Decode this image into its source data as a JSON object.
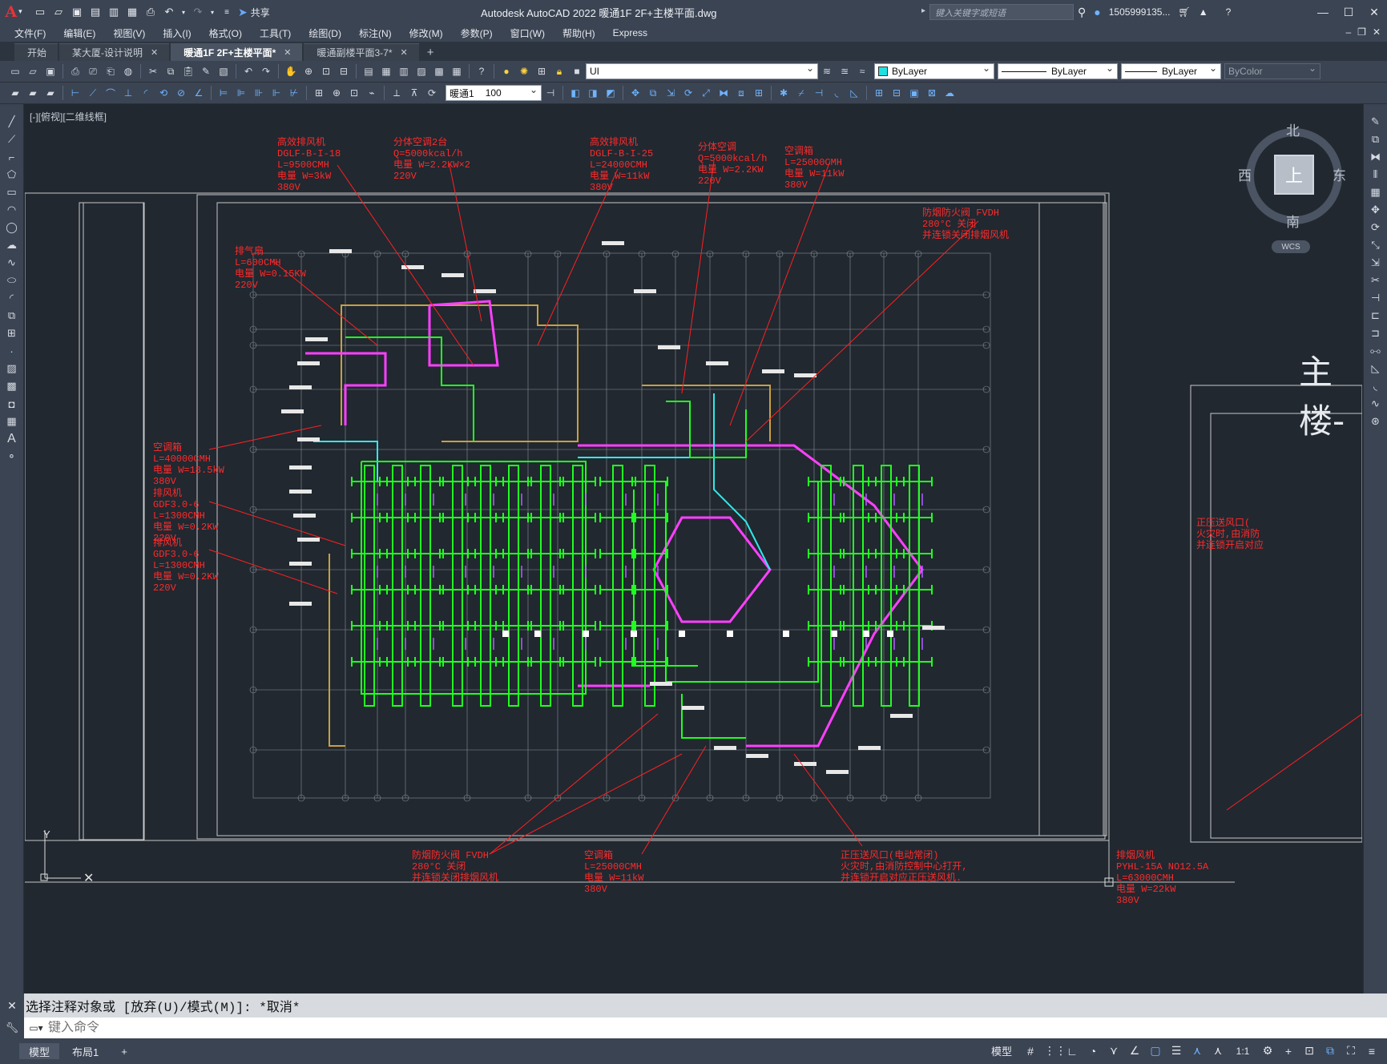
{
  "titlebar": {
    "app_logo": "A",
    "share_label": "共享",
    "title": "Autodesk AutoCAD 2022    暖通1F 2F+主楼平面.dwg",
    "search_placeholder": "键入关键字或短语",
    "user": "1505999135...",
    "quick_access_icons": [
      "new-icon",
      "open-icon",
      "save-icon",
      "saveas-icon",
      "publish-icon",
      "plot-icon",
      "undo-icon",
      "redo-icon"
    ]
  },
  "menubar": {
    "items": [
      "文件(F)",
      "编辑(E)",
      "视图(V)",
      "插入(I)",
      "格式(O)",
      "工具(T)",
      "绘图(D)",
      "标注(N)",
      "修改(M)",
      "参数(P)",
      "窗口(W)",
      "帮助(H)",
      "Express"
    ]
  },
  "tabs": [
    {
      "label": "开始",
      "active": false,
      "closable": false
    },
    {
      "label": "某大厦-设计说明",
      "active": false,
      "closable": true
    },
    {
      "label": "暖通1F 2F+主楼平面*",
      "active": true,
      "closable": true
    },
    {
      "label": "暖通副楼平面3-7*",
      "active": false,
      "closable": true
    }
  ],
  "toolbar": {
    "layer_value": "UI",
    "color_value": "ByLayer",
    "linetype_value": "ByLayer",
    "lineweight_value": "ByLayer",
    "plotstyle_value": "ByColor",
    "dimstyle_value": "暖通1",
    "scale_value": "100"
  },
  "viewport": {
    "label": "[-][俯视][二维线框]",
    "viewcube": {
      "north": "北",
      "south": "南",
      "east": "东",
      "west": "西",
      "top": "上",
      "wcs": "WCS"
    },
    "side_label": "主楼-"
  },
  "annotations": [
    {
      "text": "高效排风机\nDGLF-B-I-18\nL=9500CMH\n电量 W=3kW\n380V"
    },
    {
      "text": "分体空调2台\nQ=5000kcal/h\n电量 W=2.2KW×2\n220V"
    },
    {
      "text": "高效排风机\nDGLF-B-I-25\nL=24000CMH\n电量 W=11kW\n380V"
    },
    {
      "text": "分体空调\nQ=5000kcal/h\n电量 W=2.2KW\n220V"
    },
    {
      "text": "空调箱\nL=25000CMH\n电量 W=11kW\n380V"
    },
    {
      "text": "防烟防火阀 FVDH\n280°C 关闭\n并连锁关闭排烟风机"
    },
    {
      "text": "排气扇\nL=600CMH\n电量 W=0.15KW\n220V"
    },
    {
      "text": "空调箱\nL=40000CMH\n电量 W=18.5kW\n380V"
    },
    {
      "text": "排风机\nGDF3.0-6\nL=1300CMH\n电量 W=0.2KW\n220V"
    },
    {
      "text": "排风机\nGDF3.0-6\nL=1300CMH\n电量 W=0.2KW\n220V"
    },
    {
      "text": "防烟防火阀 FVDH\n280°C 关闭\n并连锁关闭排烟风机"
    },
    {
      "text": "空调箱\nL=25000CMH\n电量 W=11kW\n380V"
    },
    {
      "text": "正压送风口(电动常闭)\n火灾时,由消防控制中心打开,\n并连锁开启对应正压送风机."
    },
    {
      "text": "排烟风机\nPYHL-15A NO12.5A\nL=63000CMH\n电量 W=22kW\n380V"
    },
    {
      "text": "正压送风口(\n火灾时,由消防\n并连锁开启对应"
    }
  ],
  "command": {
    "history": "选择注释对象或 [放弃(U)/模式(M)]: *取消*",
    "placeholder": "键入命令"
  },
  "statusbar": {
    "layout_tabs": [
      "模型",
      "布局1"
    ],
    "model_label": "模型",
    "scale": "1:1"
  }
}
